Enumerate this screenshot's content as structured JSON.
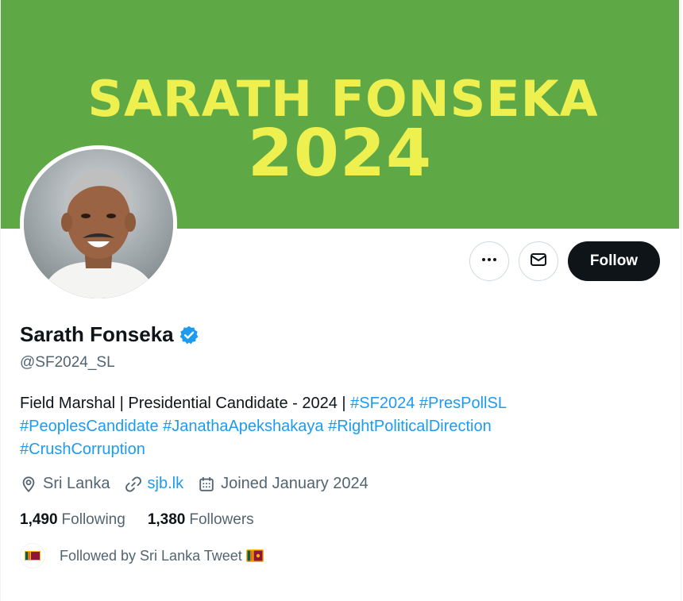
{
  "banner": {
    "line1": "SARATH FONSEKA",
    "line2": "2024",
    "background_color": "#5ea845",
    "text_color": "#edf04f"
  },
  "profile": {
    "display_name": "Sarath Fonseka",
    "verified": true,
    "handle": "@SF2024_SL"
  },
  "actions": {
    "more_icon": "more-horizontal-icon",
    "message_icon": "envelope-icon",
    "follow_label": "Follow"
  },
  "bio": {
    "text": "Field Marshal | Presidential Candidate - 2024 |",
    "hashtags": [
      "#SF2024",
      "#PresPollSL",
      "#PeoplesCandidate",
      "#JanathaApekshakaya",
      "#RightPoliticalDirection",
      "#CrushCorruption"
    ]
  },
  "meta": {
    "location": "Sri Lanka",
    "website": "sjb.lk",
    "joined": "Joined January 2024"
  },
  "stats": {
    "following_count": "1,490",
    "following_label": "Following",
    "followers_count": "1,380",
    "followers_label": "Followers"
  },
  "followed_by": {
    "text": "Followed by Sri Lanka Tweet",
    "flag_icon": "sri-lanka-flag-icon"
  },
  "colors": {
    "link": "#1d9bf0",
    "secondary_text": "#536471",
    "primary_text": "#0f1419",
    "verified_badge": "#1d9bf0"
  }
}
